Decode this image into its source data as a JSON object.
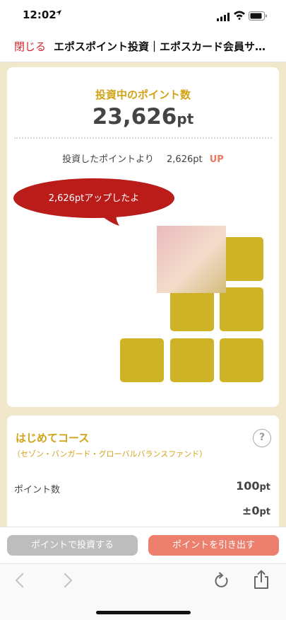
{
  "status_bar": {
    "time": "12:02",
    "location_icon": "location-arrow-icon",
    "icons": [
      "cellular-signal-icon",
      "wifi-icon",
      "battery-icon"
    ]
  },
  "navbar": {
    "close_label": "閉じる",
    "title": "エポスポイント投資｜エポスカード会員サ…"
  },
  "summary": {
    "heading": "投資中のポイント数",
    "points_value": "23,626",
    "points_unit": "pt",
    "gain_label": "投資したポイントより",
    "gain_value": "2,626pt",
    "gain_badge": "UP"
  },
  "bubble": {
    "text": "2,626ptアップしたよ"
  },
  "course": {
    "title": "はじめてコース",
    "subtitle": "（セゾン・バンガード・グローバルバランスファンド）",
    "help_icon": "question-circle-icon",
    "row_label": "ポイント数",
    "row_value": "100",
    "row_unit": "pt",
    "row2_value": "±0",
    "row2_unit": "pt"
  },
  "actions": {
    "invest_label": "ポイントで投資する",
    "withdraw_label": "ポイントを引き出す"
  },
  "browser_toolbar": {
    "icons": [
      "back-arrow-icon",
      "forward-arrow-icon",
      "reload-icon",
      "share-icon"
    ]
  },
  "colors": {
    "accent_gold": "#d1a317",
    "block_gold": "#cfb326",
    "bubble_red": "#b91c19",
    "close_red": "#d2282c",
    "withdraw_button": "#ec7f6e",
    "invest_button": "#bdbdbd",
    "background_cream": "#f1e8cc"
  }
}
